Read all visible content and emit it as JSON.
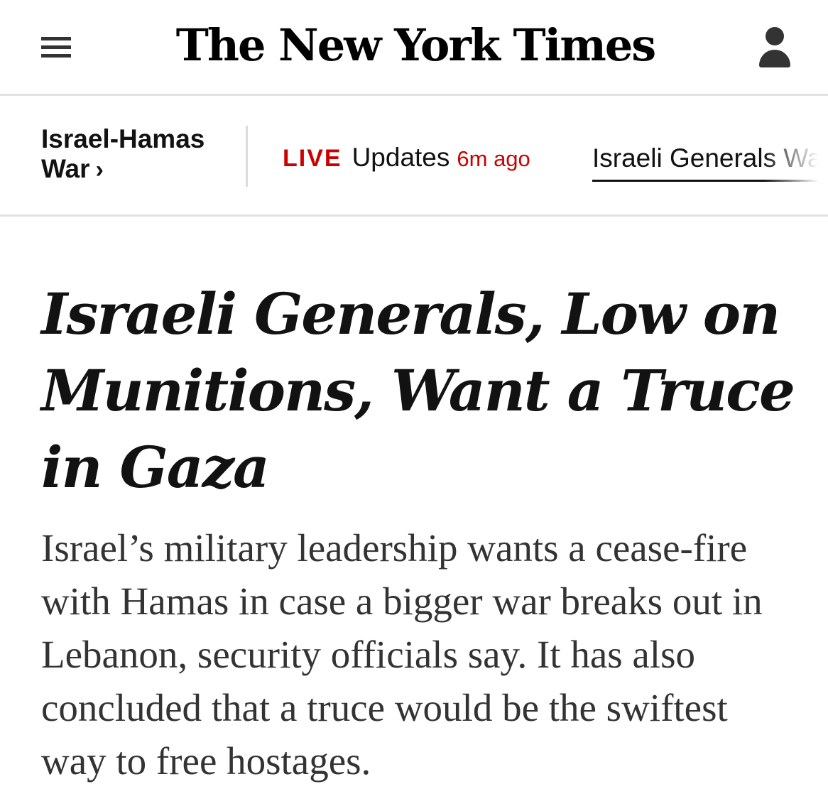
{
  "masthead": {
    "logo_text": "The New York Times",
    "menu_icon": "hamburger-menu-icon",
    "account_icon": "person-icon"
  },
  "section_bar": {
    "section_title": "Israel-Hamas War",
    "section_chevron": "›",
    "live_tag": "LIVE",
    "live_label": "Updates",
    "live_time": "6m ago",
    "current_story": "Israeli Generals Want a Truce in Gaza"
  },
  "article": {
    "headline": "Israeli Generals, Low on Munitions, Want a Truce in Gaza",
    "summary": "Israel’s military leadership wants a cease-fire with Hamas in case a bigger war breaks out in Lebanon, security officials say. It has also concluded that a truce would be the swiftest way to free hostages."
  },
  "colors": {
    "live_red": "#cc0000",
    "text": "#121212",
    "summary_text": "#333333",
    "divider": "#e2e2e2"
  }
}
